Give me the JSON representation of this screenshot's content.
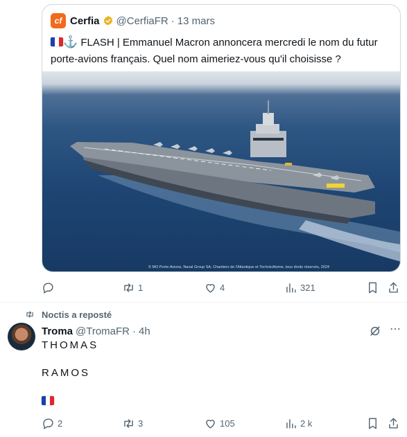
{
  "quote": {
    "logo_text": "cf",
    "author_name": "Cerfia",
    "handle": "@CerfiaFR",
    "separator": "·",
    "date": "13 mars",
    "text": "FLASH | Emmanuel Macron annoncera mercredi le nom du futur porte-avions français. Quel nom aimeriez-vous qu'il choisisse ?",
    "image_caption": "© MO Porte-Avions, Naval Group SA, Chantiers de l'Atlantique et TechnicAtome, tous droits réservés, 2024"
  },
  "quote_actions": {
    "replies": "",
    "reposts": "1",
    "likes": "4",
    "views": "321"
  },
  "repost_banner": "Noctis a reposté",
  "tweet": {
    "author_name": "Troma",
    "handle": "@TromaFR",
    "separator": "·",
    "time": "4h",
    "line1": "THOMAS",
    "line2": "RAMOS"
  },
  "tweet_actions": {
    "replies": "2",
    "reposts": "3",
    "likes": "105",
    "views": "2 k"
  },
  "colors": {
    "muted": "#536471",
    "verified_gold": "#e8b21c",
    "border": "#cfd9de"
  }
}
